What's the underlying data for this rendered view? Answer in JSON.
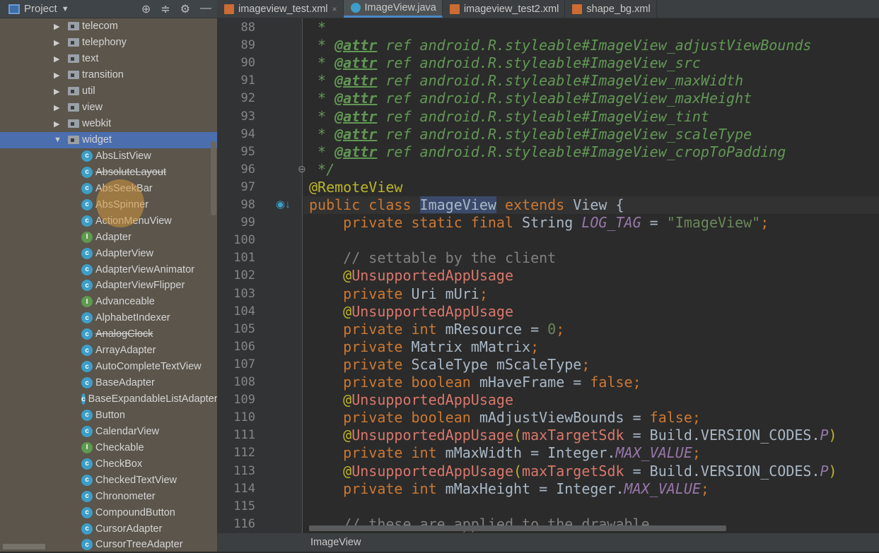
{
  "sidebar": {
    "title": "Project",
    "tools": [
      "locate-icon",
      "collapse-icon",
      "gear-icon",
      "minimize-icon"
    ],
    "packages": [
      "telecom",
      "telephony",
      "text",
      "transition",
      "util",
      "view",
      "webkit",
      "widget"
    ],
    "selected": "widget",
    "classes": [
      {
        "name": "AbsListView",
        "type": "c"
      },
      {
        "name": "AbsoluteLayout",
        "type": "c",
        "deprecated": true
      },
      {
        "name": "AbsSeekBar",
        "type": "c"
      },
      {
        "name": "AbsSpinner",
        "type": "c"
      },
      {
        "name": "ActionMenuView",
        "type": "c"
      },
      {
        "name": "Adapter",
        "type": "i"
      },
      {
        "name": "AdapterView",
        "type": "c"
      },
      {
        "name": "AdapterViewAnimator",
        "type": "c"
      },
      {
        "name": "AdapterViewFlipper",
        "type": "c"
      },
      {
        "name": "Advanceable",
        "type": "i"
      },
      {
        "name": "AlphabetIndexer",
        "type": "c"
      },
      {
        "name": "AnalogClock",
        "type": "c",
        "deprecated": true
      },
      {
        "name": "ArrayAdapter",
        "type": "c"
      },
      {
        "name": "AutoCompleteTextView",
        "type": "c"
      },
      {
        "name": "BaseAdapter",
        "type": "c"
      },
      {
        "name": "BaseExpandableListAdapter",
        "type": "c"
      },
      {
        "name": "Button",
        "type": "c"
      },
      {
        "name": "CalendarView",
        "type": "c"
      },
      {
        "name": "Checkable",
        "type": "i"
      },
      {
        "name": "CheckBox",
        "type": "c"
      },
      {
        "name": "CheckedTextView",
        "type": "c"
      },
      {
        "name": "Chronometer",
        "type": "c"
      },
      {
        "name": "CompoundButton",
        "type": "c"
      },
      {
        "name": "CursorAdapter",
        "type": "c"
      },
      {
        "name": "CursorTreeAdapter",
        "type": "c"
      }
    ]
  },
  "tabs": [
    {
      "label": "imageview_test.xml",
      "icon": "xml",
      "close": "×"
    },
    {
      "label": "ImageView.java",
      "icon": "java",
      "active": true
    },
    {
      "label": "imageview_test2.xml",
      "icon": "xml"
    },
    {
      "label": "shape_bg.xml",
      "icon": "xml"
    }
  ],
  "editor": {
    "first_line": 88,
    "current_line": 98,
    "lines": [
      [
        [
          "doc",
          " *"
        ]
      ],
      [
        [
          "doc",
          " * "
        ],
        [
          "doctag",
          "@attr"
        ],
        [
          "doc",
          " ref android.R.styleable#ImageView_adjustViewBounds"
        ]
      ],
      [
        [
          "doc",
          " * "
        ],
        [
          "doctag",
          "@attr"
        ],
        [
          "doc",
          " ref android.R.styleable#ImageView_src"
        ]
      ],
      [
        [
          "doc",
          " * "
        ],
        [
          "doctag",
          "@attr"
        ],
        [
          "doc",
          " ref android.R.styleable#ImageView_maxWidth"
        ]
      ],
      [
        [
          "doc",
          " * "
        ],
        [
          "doctag",
          "@attr"
        ],
        [
          "doc",
          " ref android.R.styleable#ImageView_maxHeight"
        ]
      ],
      [
        [
          "doc",
          " * "
        ],
        [
          "doctag",
          "@attr"
        ],
        [
          "doc",
          " ref android.R.styleable#ImageView_tint"
        ]
      ],
      [
        [
          "doc",
          " * "
        ],
        [
          "doctag",
          "@attr"
        ],
        [
          "doc",
          " ref android.R.styleable#ImageView_scaleType"
        ]
      ],
      [
        [
          "doc",
          " * "
        ],
        [
          "doctag",
          "@attr"
        ],
        [
          "doc",
          " ref android.R.styleable#ImageView_cropToPadding"
        ]
      ],
      [
        [
          "doc",
          " */"
        ]
      ],
      [
        [
          "ann",
          "@RemoteView"
        ]
      ],
      [
        [
          "kw",
          "public class "
        ],
        [
          "hl",
          "ImageView"
        ],
        [
          "kw",
          " extends "
        ],
        [
          "p",
          "View {"
        ]
      ],
      [
        [
          "kw",
          "    private static final "
        ],
        [
          "p",
          "String "
        ],
        [
          "stf",
          "LOG_TAG"
        ],
        [
          "p",
          " = "
        ],
        [
          "str",
          "\"ImageView\""
        ],
        [
          "kw",
          ";"
        ]
      ],
      [],
      [
        [
          "cm",
          "    // settable by the client"
        ]
      ],
      [
        [
          "ann",
          "    @"
        ],
        [
          "red",
          "UnsupportedAppUsage"
        ]
      ],
      [
        [
          "kw",
          "    private "
        ],
        [
          "p",
          "Uri mUri"
        ],
        [
          "kw",
          ";"
        ]
      ],
      [
        [
          "ann",
          "    @"
        ],
        [
          "red",
          "UnsupportedAppUsage"
        ]
      ],
      [
        [
          "kw",
          "    private int "
        ],
        [
          "p",
          "mResource = "
        ],
        [
          "str",
          "0"
        ],
        [
          "kw",
          ";"
        ]
      ],
      [
        [
          "kw",
          "    private "
        ],
        [
          "p",
          "Matrix mMatrix"
        ],
        [
          "kw",
          ";"
        ]
      ],
      [
        [
          "kw",
          "    private "
        ],
        [
          "p",
          "ScaleType mScaleType"
        ],
        [
          "kw",
          ";"
        ]
      ],
      [
        [
          "kw",
          "    private boolean "
        ],
        [
          "p",
          "mHaveFrame = "
        ],
        [
          "kw",
          "false;"
        ]
      ],
      [
        [
          "ann",
          "    @"
        ],
        [
          "red",
          "UnsupportedAppUsage"
        ]
      ],
      [
        [
          "kw",
          "    private boolean "
        ],
        [
          "p",
          "mAdjustViewBounds = "
        ],
        [
          "kw",
          "false;"
        ]
      ],
      [
        [
          "ann",
          "    @"
        ],
        [
          "red",
          "UnsupportedAppUsage"
        ],
        [
          "ann",
          "("
        ],
        [
          "red",
          "maxTargetSdk"
        ],
        [
          "p",
          " = Build.VERSION_CODES."
        ],
        [
          "stf",
          "P"
        ],
        [
          "ann",
          ")"
        ]
      ],
      [
        [
          "kw",
          "    private int "
        ],
        [
          "p",
          "mMaxWidth = Integer."
        ],
        [
          "stf",
          "MAX_VALUE"
        ],
        [
          "kw",
          ";"
        ]
      ],
      [
        [
          "ann",
          "    @"
        ],
        [
          "red",
          "UnsupportedAppUsage"
        ],
        [
          "ann",
          "("
        ],
        [
          "red",
          "maxTargetSdk"
        ],
        [
          "p",
          " = Build.VERSION_CODES."
        ],
        [
          "stf",
          "P"
        ],
        [
          "ann",
          ")"
        ]
      ],
      [
        [
          "kw",
          "    private int "
        ],
        [
          "p",
          "mMaxHeight = Integer."
        ],
        [
          "stf",
          "MAX_VALUE"
        ],
        [
          "kw",
          ";"
        ]
      ],
      [],
      [
        [
          "cm",
          "    // these are applied to the drawable"
        ]
      ]
    ]
  },
  "breadcrumb": "ImageView"
}
